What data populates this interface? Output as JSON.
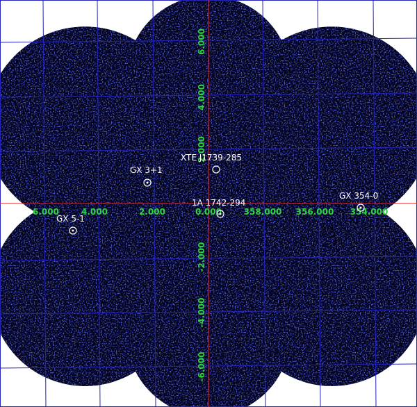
{
  "colors": {
    "background": "#ffffff",
    "sky_field": "#03031c",
    "grid": "#2424b8",
    "axis": "#ff1a1a",
    "tick_labels": "#2bd63a",
    "source_marker": "#ffffff",
    "noise": "#1a22d6"
  },
  "axes": {
    "glon_ticks": [
      "6.000",
      "4.000",
      "2.000",
      "0.000",
      "358.000",
      "356.000",
      "354.000"
    ],
    "glat_ticks": [
      "6.000",
      "4.000",
      "2.000",
      "-2.000",
      "-4.000",
      "-6.000"
    ]
  },
  "sources": [
    {
      "name": "XTE J1739-285"
    },
    {
      "name": "GX 3+1"
    },
    {
      "name": "GX 354-0"
    },
    {
      "name": "1A 1742-294"
    },
    {
      "name": "GX 5-1"
    }
  ]
}
